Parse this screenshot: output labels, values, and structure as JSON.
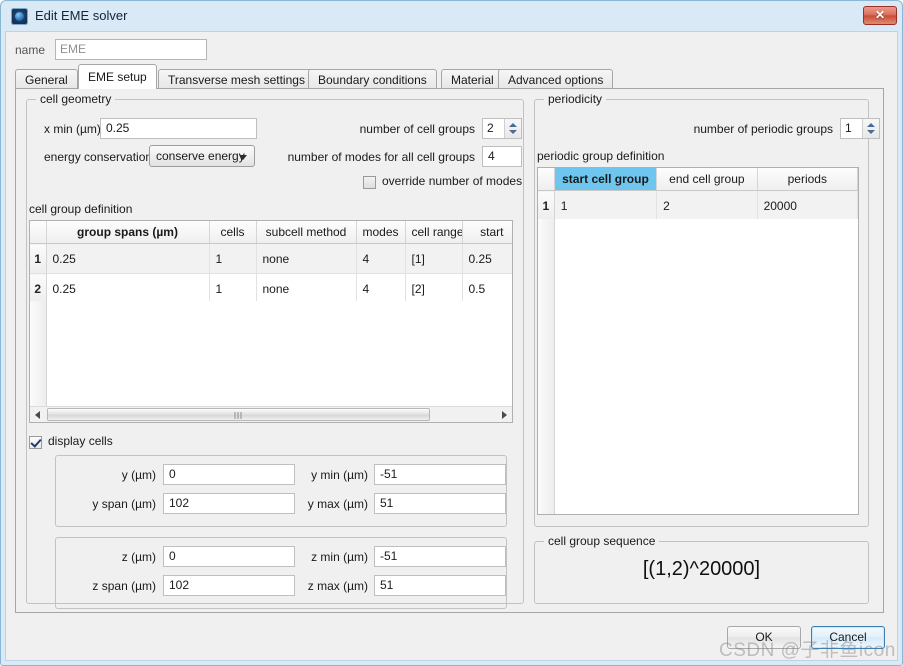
{
  "window": {
    "title": "Edit EME solver",
    "icon": "app-icon",
    "close_label": "✕"
  },
  "name_row": {
    "label": "name",
    "value": "EME"
  },
  "tabs": [
    {
      "label": "General",
      "active": false
    },
    {
      "label": "EME setup",
      "active": true
    },
    {
      "label": "Transverse mesh settings",
      "active": false
    },
    {
      "label": "Boundary conditions",
      "active": false
    },
    {
      "label": "Material",
      "active": false
    },
    {
      "label": "Advanced options",
      "active": false
    }
  ],
  "cell_geometry": {
    "title": "cell geometry",
    "x_min_label": "x min (µm)",
    "x_min_value": "0.25",
    "energy_conservation_label": "energy conservation",
    "energy_conservation_value": "conserve energy",
    "number_of_cell_groups_label": "number of cell groups",
    "number_of_cell_groups_value": "2",
    "number_of_modes_label": "number of modes for all cell groups",
    "number_of_modes_value": "4",
    "override_modes_label": "override number of modes",
    "override_modes_checked": false,
    "cell_group_definition_label": "cell group definition",
    "table": {
      "columns": [
        "",
        "group spans (µm)",
        "cells",
        "subcell method",
        "modes",
        "cell range",
        "start"
      ],
      "rows": [
        {
          "num": "1",
          "cells": [
            "0.25",
            "1",
            "none",
            "4",
            "[1]",
            "0.25"
          ]
        },
        {
          "num": "2",
          "cells": [
            "0.25",
            "1",
            "none",
            "4",
            "[2]",
            "0.5"
          ]
        }
      ]
    },
    "display_cells_label": "display cells",
    "display_cells_checked": true,
    "y_label": "y (µm)",
    "y_value": "0",
    "y_span_label": "y span (µm)",
    "y_span_value": "102",
    "y_min_label": "y min (µm)",
    "y_min_value": "-51",
    "y_max_label": "y max (µm)",
    "y_max_value": "51",
    "z_label": "z (µm)",
    "z_value": "0",
    "z_span_label": "z span (µm)",
    "z_span_value": "102",
    "z_min_label": "z min (µm)",
    "z_min_value": "-51",
    "z_max_label": "z max (µm)",
    "z_max_value": "51"
  },
  "periodicity": {
    "title": "periodicity",
    "number_of_periodic_groups_label": "number of periodic groups",
    "number_of_periodic_groups_value": "1",
    "periodic_group_definition_label": "periodic group definition",
    "table": {
      "columns": [
        "",
        "start cell group",
        "end cell group",
        "periods"
      ],
      "rows": [
        {
          "num": "1",
          "cells": [
            "1",
            "2",
            "20000"
          ]
        }
      ]
    }
  },
  "cell_group_sequence": {
    "title": "cell group sequence",
    "value": "[(1,2)^20000]"
  },
  "buttons": {
    "ok": "OK",
    "cancel": "Cancel"
  },
  "watermark": {
    "text": "CSDN @子非鱼icon"
  },
  "colors": {
    "selected_header": "#6ec6ee",
    "title_bar": "#d9e9f5",
    "dialog_bg": "#f0f0f0",
    "close_button": "#c94a33",
    "default_button_border": "#3c7fb1"
  }
}
